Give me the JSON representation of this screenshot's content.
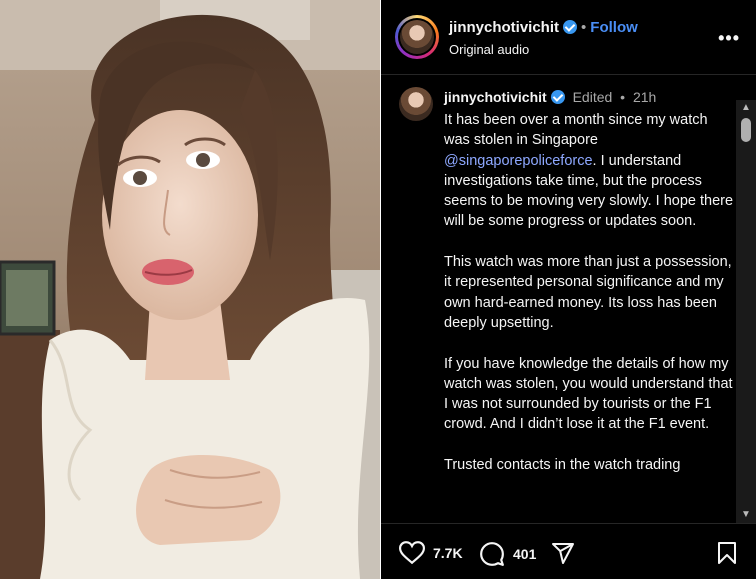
{
  "header": {
    "username": "jinnychotivichit",
    "separator": "•",
    "follow_label": "Follow",
    "subtitle": "Original audio",
    "more_label": "•••"
  },
  "comment": {
    "username": "jinnychotivichit",
    "edited": "Edited",
    "separator": "•",
    "time": "21h",
    "text_part1": "It has been over a month since my watch was stolen in Singapore ",
    "mention": "@singaporepoliceforce",
    "text_part2": ". I understand investigations take time, but the process seems to be moving very slowly. I hope there will be some progress or updates soon.\n\nThis watch was more than just a possession, it represented personal significance and my own hard-earned money. Its loss has been deeply upsetting.\n\nIf you have knowledge the details of how my watch was stolen, you would understand that I was not surrounded by tourists or the F1 crowd. And I didn’t lose it at the F1 event.\n\nTrusted contacts in the watch trading"
  },
  "actions": {
    "likes": "7.7K",
    "comments": "401",
    "icons": [
      "heart-icon",
      "comment-icon",
      "share-icon",
      "bookmark-icon"
    ]
  },
  "colors": {
    "follow": "#4a8ef5",
    "mention": "#8ea8ff",
    "verified": "#3897f0"
  }
}
